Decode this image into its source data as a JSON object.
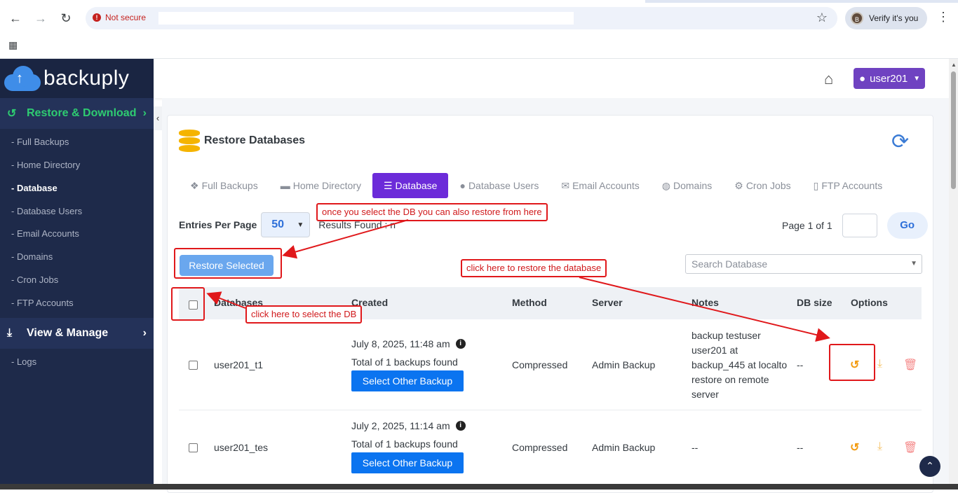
{
  "browser": {
    "not_secure": "Not secure",
    "verify_label": "Verify it's you",
    "avatar_letter": "B"
  },
  "sidebar": {
    "logo_text": "backuply",
    "restore_section": "Restore & Download",
    "items": [
      {
        "label": "- Full Backups"
      },
      {
        "label": "- Home Directory"
      },
      {
        "label": "- Database"
      },
      {
        "label": "- Database Users"
      },
      {
        "label": "- Email Accounts"
      },
      {
        "label": "- Domains"
      },
      {
        "label": "- Cron Jobs"
      },
      {
        "label": "- FTP Accounts"
      }
    ],
    "active_item": "- Database",
    "view_section": "View & Manage",
    "logs": "- Logs"
  },
  "header": {
    "user": "user201"
  },
  "card": {
    "title": "Restore Databases",
    "tabs": [
      {
        "label": "Full Backups",
        "icon": "cubes-icon"
      },
      {
        "label": "Home Directory",
        "icon": "folder-icon"
      },
      {
        "label": "Database",
        "icon": "database-icon"
      },
      {
        "label": "Database Users",
        "icon": "user-icon"
      },
      {
        "label": "Email Accounts",
        "icon": "envelope-icon"
      },
      {
        "label": "Domains",
        "icon": "globe-icon"
      },
      {
        "label": "Cron Jobs",
        "icon": "users-cog-icon"
      },
      {
        "label": "FTP Accounts",
        "icon": "file-icon"
      }
    ],
    "entries_label": "Entries Per Page",
    "entries_value": "50",
    "results_label": "Results Found : n",
    "page_label": "Page 1 of 1",
    "go_label": "Go",
    "restore_selected": "Restore Selected",
    "search_placeholder": "Search Database"
  },
  "table": {
    "columns": [
      "Databases",
      "Created",
      "Method",
      "Server",
      "Notes",
      "DB size",
      "Options"
    ],
    "rows": [
      {
        "name": "user201_t1",
        "date": "July 8, 2025, 11:48 am",
        "count": "Total of 1 backups found",
        "button": "Select Other Backup",
        "method": "Compressed",
        "server": "Admin Backup",
        "notes": "backup testuser user201 at backup_445 at localto restore on remote server",
        "size": "--"
      },
      {
        "name": "user201_tes",
        "date": "July 2, 2025, 11:14 am",
        "count": "Total of 1 backups found",
        "button": "Select Other Backup",
        "method": "Compressed",
        "server": "Admin Backup",
        "notes": "--",
        "size": "--"
      }
    ]
  },
  "annotations": {
    "restore_from_here": "once you select the DB you can also restore from here",
    "restore_database": "click here to restore the database",
    "select_db": "click here to select the DB"
  },
  "colors": {
    "sidebar": "#1e2a4a",
    "accent_purple": "#6c2bd9",
    "annotation_red": "#e0181b",
    "restore_green": "#2ecc71"
  }
}
